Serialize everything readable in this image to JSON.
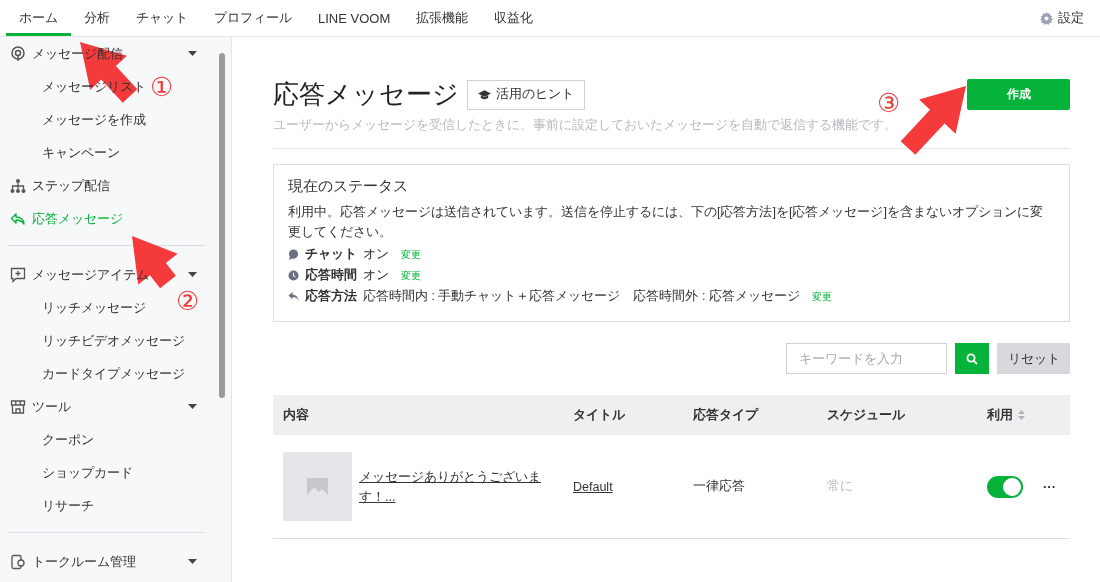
{
  "top_nav": {
    "tabs": [
      {
        "label": "ホーム",
        "selected": true
      },
      {
        "label": "分析",
        "selected": false
      },
      {
        "label": "チャット",
        "selected": false
      },
      {
        "label": "プロフィール",
        "selected": false
      },
      {
        "label": "LINE VOOM",
        "selected": false
      },
      {
        "label": "拡張機能",
        "selected": false
      },
      {
        "label": "収益化",
        "selected": false
      }
    ],
    "settings": "設定"
  },
  "sidebar": {
    "groups": [
      {
        "label": "メッセージ配信",
        "kind": "section",
        "selected": false,
        "children": [
          {
            "label": "メッセージリスト",
            "selected": false
          },
          {
            "label": "メッセージを作成",
            "selected": false
          },
          {
            "label": "キャンペーン",
            "selected": false
          }
        ]
      },
      {
        "label": "ステップ配信",
        "kind": "link",
        "selected": false
      },
      {
        "label": "応答メッセージ",
        "kind": "link",
        "selected": true,
        "divider_after": true
      },
      {
        "label": "メッセージアイテム",
        "kind": "section",
        "selected": false,
        "children": [
          {
            "label": "リッチメッセージ",
            "selected": false
          },
          {
            "label": "リッチビデオメッセージ",
            "selected": false
          },
          {
            "label": "カードタイプメッセージ",
            "selected": false
          }
        ]
      },
      {
        "label": "ツール",
        "kind": "section",
        "selected": false,
        "divider_after": true,
        "children": [
          {
            "label": "クーポン",
            "selected": false
          },
          {
            "label": "ショップカード",
            "selected": false
          },
          {
            "label": "リサーチ",
            "selected": false
          }
        ]
      },
      {
        "label": "トークルーム管理",
        "kind": "section",
        "selected": false
      }
    ]
  },
  "page": {
    "title": "応答メッセージ",
    "hint_button": "活用のヒント",
    "description": "ユーザーからメッセージを受信したときに、事前に設定しておいたメッセージを自動で返信する機能です。",
    "create_button": "作成"
  },
  "status": {
    "title": "現在のステータス",
    "message": "利用中。応答メッセージは送信されています。送信を停止するには、下の[応答方法]を[応答メッセージ]を含まないオプションに変更してください。",
    "rows": [
      {
        "label": "チャット",
        "value": "オン",
        "change": "変更"
      },
      {
        "label": "応答時間",
        "value": "オン",
        "change": "変更"
      },
      {
        "label": "応答方法",
        "value": "応答時間内 : 手動チャット＋応答メッセージ　応答時間外 : 応答メッセージ",
        "change": "変更"
      }
    ]
  },
  "search": {
    "placeholder": "キーワードを入力",
    "reset": "リセット"
  },
  "table": {
    "columns": [
      {
        "label": "内容",
        "sortable": false
      },
      {
        "label": "タイトル",
        "sortable": false
      },
      {
        "label": "応答タイプ",
        "sortable": false
      },
      {
        "label": "スケジュール",
        "sortable": false
      },
      {
        "label": "利用",
        "sortable": true
      }
    ],
    "rows": [
      {
        "content": "メッセージありがとうございます！...",
        "title": "Default",
        "type": "一律応答",
        "schedule": "常に",
        "on": true,
        "more": "···"
      }
    ]
  },
  "annotations": [
    {
      "label": "①"
    },
    {
      "label": "②"
    },
    {
      "label": "③"
    }
  ]
}
